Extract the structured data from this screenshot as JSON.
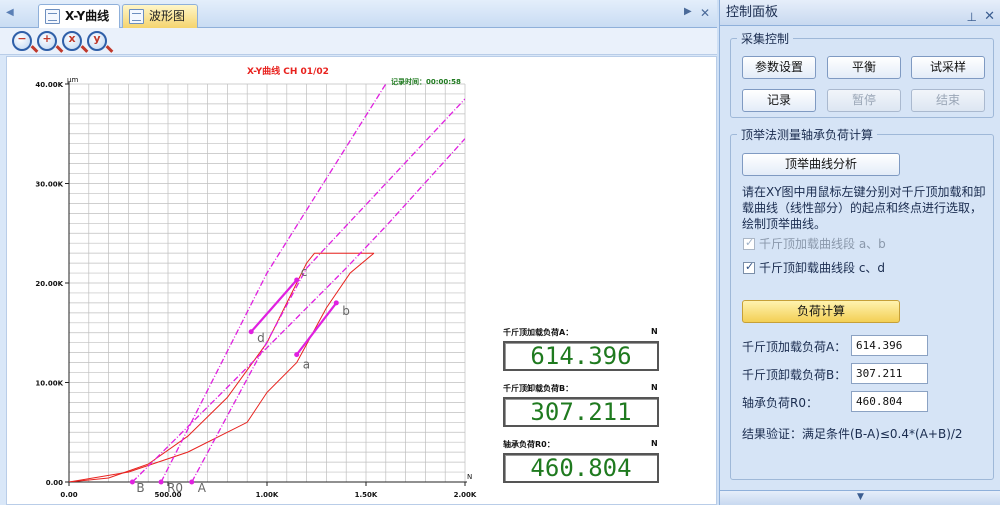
{
  "tabs": [
    {
      "label": "X-Y曲线",
      "active": true
    },
    {
      "label": "波形图",
      "active": false
    }
  ],
  "toolbar": {
    "zoom_buttons": [
      "zoom-fit-icon",
      "zoom-in-icon",
      "zoom-out-x-icon",
      "zoom-out-y-icon"
    ]
  },
  "plot": {
    "title": "X-Y曲线 CH 01/02",
    "record_time": "记录时间：00:00:58",
    "y_unit": "μm",
    "x_unit": "N",
    "y_ticks": [
      "0.00",
      "10.00K",
      "20.00K",
      "30.00K",
      "40.00K"
    ],
    "x_ticks": [
      "0.00",
      "500.00",
      "1.00K",
      "1.50K",
      "2.00K"
    ],
    "point_labels": {
      "a": "a",
      "b": "b",
      "c": "c",
      "d": "d",
      "A": "A",
      "B": "B",
      "R0": "R0"
    }
  },
  "chart_data": {
    "type": "line",
    "title": "X-Y曲线 CH 01/02",
    "xlim": [
      0,
      2000
    ],
    "ylim": [
      0,
      40000
    ],
    "grid": true,
    "series": [
      {
        "values": [
          [
            0,
            0
          ],
          [
            200,
            400
          ],
          [
            400,
            1800
          ],
          [
            600,
            4600
          ],
          [
            800,
            8500
          ],
          [
            1000,
            14000
          ],
          [
            1200,
            22000
          ],
          [
            1240,
            23000
          ],
          [
            1540,
            23000
          ]
        ]
      },
      {
        "values": [
          [
            0,
            0
          ],
          [
            300,
            1000
          ],
          [
            600,
            3000
          ],
          [
            900,
            6000
          ],
          [
            1000,
            9000
          ],
          [
            1150,
            12000
          ],
          [
            1300,
            17500
          ],
          [
            1420,
            21000
          ],
          [
            1540,
            23000
          ]
        ]
      },
      {
        "values": [
          [
            320,
            0
          ],
          [
            1000,
            13500
          ],
          [
            1400,
            21500
          ],
          [
            1600,
            25700
          ],
          [
            2000,
            34500
          ]
        ]
      },
      {
        "values": [
          [
            465,
            0
          ],
          [
            1000,
            21000
          ],
          [
            1600,
            40000
          ]
        ]
      },
      {
        "values": [
          [
            620,
            0
          ],
          [
            1200,
            21500
          ],
          [
            2000,
            38500
          ]
        ]
      }
    ],
    "labeled_points": [
      {
        "name": "a",
        "x": 1150,
        "y": 12800
      },
      {
        "name": "b",
        "x": 1350,
        "y": 18000
      },
      {
        "name": "c",
        "x": 1150,
        "y": 20300
      },
      {
        "name": "d",
        "x": 920,
        "y": 15100
      },
      {
        "name": "B",
        "x": 320,
        "y": 0
      },
      {
        "name": "R0",
        "x": 465,
        "y": 0
      },
      {
        "name": "A",
        "x": 620,
        "y": 0
      }
    ]
  },
  "readouts": [
    {
      "label": "千斤顶加载负荷A：",
      "unit": "N",
      "value": "614.396"
    },
    {
      "label": "千斤顶卸载负荷B：",
      "unit": "N",
      "value": "307.211"
    },
    {
      "label": "轴承负荷R0：",
      "unit": "N",
      "value": "460.804"
    }
  ],
  "panel": {
    "title": "控制面板",
    "acq_group": "采集控制",
    "btn_params": "参数设置",
    "btn_balance": "平衡",
    "btn_trial": "试采样",
    "btn_record": "记录",
    "btn_pause": "暂停",
    "btn_end": "结束",
    "calc_group": "顶举法测量轴承负荷计算",
    "btn_analyze": "顶举曲线分析",
    "description": "请在XY图中用鼠标左键分别对千斤顶加载和卸载曲线（线性部分）的起点和终点进行选取，绘制顶举曲线。",
    "chk_load": "千斤顶加载曲线段 a、b",
    "chk_unload": "千斤顶卸载曲线段 c、d",
    "btn_calc": "负荷计算",
    "field_a_label": "千斤顶加载负荷A：",
    "field_a_value": "614.396",
    "field_b_label": "千斤顶卸载负荷B：",
    "field_b_value": "307.211",
    "field_r_label": "轴承负荷R0：",
    "field_r_value": "460.804",
    "verify": "结果验证：满足条件(B-A)≤0.4*(A+B)/2"
  },
  "colors": {
    "curve": "#e8221e",
    "fit_line": "#e020e0",
    "readout_digits": "#1f7a1f",
    "accent_button": "#f3cf55"
  }
}
